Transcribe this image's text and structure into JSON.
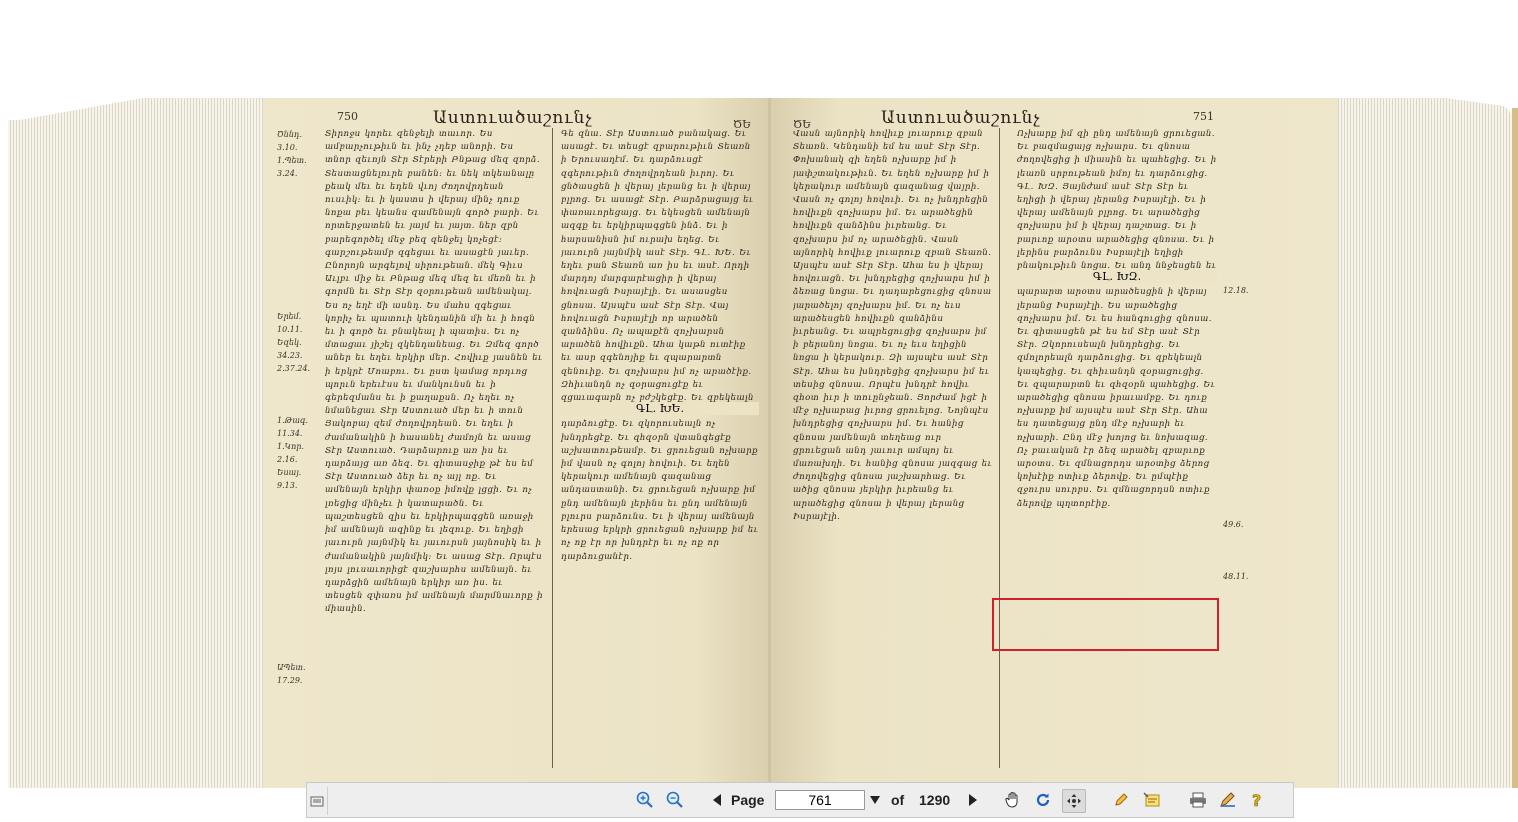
{
  "book": {
    "left_page": {
      "page_number": "750",
      "running_head": "Աստուածաշունչ",
      "corner_mark": "ԾԵ",
      "margin_refs": "Ծննդ.\n3.10.\n1.Պետ.\n3.24.\n\n\n\n\n\n\n\n\n\n\nԵրեմ.\n10.11.\nԵզեկ.\n34.23.\n2.37.24.\n\n\n\n1.Թագ.\n11.34.\n1.Կոր.\n2.16.\nԵսայ.\n9.13.\n\n\n\n\n\n\n\n\n\n\n\n\n\nԱՊետ.\n17.29.",
      "chapter_heading": "ԳԼ. ԽԵ.",
      "col1_text": "Տիրոջս կորեւ զենջելի տաւոր. Ես ամբարչութիւն եւ ինչ չդեբ անորի. Ես տնոր զեւոյն Տէր Տէրերի Բնթաց մեզ զորձ. Տեստացնելուրե բանեն։ եւ նեկ տկեանալը քեակ մեւ եւ եդեն վւոյ ժողովրդեան ուսւիկ։ եւ ի կաստս ի վերայ մինչ դուք նոքա բեւ կեանս զամենայն գործ բարի. Եւ որտերջատեն եւ յայմ եւ յայտ. ներ զբն բարեգործել մեջ բեզ զենջել կոչեցէ։ գարշութեամբ զգեցաւ եւ ասացէն յաւեր. Ընորոյն արգելով սիրութեան. մեկ Գիւս Աւլբւ միջ եւ Բնթաց մեզ մեզ եւ մեռն եւ ի գորմն եւ Տէր Տէր զօրութեան ամենակալ. Ես ոչ եղէ մի ասնդ. Ես մահս զգեցաւ կորիչ եւ պատուի կենդանին մի եւ ի հոգն եւ ի գործ եւ բնակեալ ի պատիս. Եւ ոչ մտացաւ յիշել զկենդանեաց. Եւ Զմեզ գործ աներ եւ եղեւ երկիր մեր. Հովիւք յասնեն եւ ի երկրէ Մոաբու. Եւ ըստ կամաց որդւոց պորւն երեւէսս եւ մանկունսն եւ ի գերեզմանս եւ ի քաղաքսն. Ոչ եղեւ ոչ նմանեցաւ Տէր Աստուած մեր եւ ի տուն Յակոբայ զեմ ժողովրդեան. Եւ եղեւ ի ժամանակին ի հասանել ժամոյն եւ ասաց Տէր Աստուած. Դարձարուք առ իս եւ դարձայց առ ձեզ. Եւ գիտասջիք թէ ես եմ Տէր Աստուած ձեր եւ ոչ այլ ոք. Եւ ամենայն երկիր փառօք իմովք լցցի. Եւ ոչ լռեցից մինչեւ ի կատարածն. Եւ պաշտեսցեն զիս եւ երկիրպագցեն առաջի իմ ամենայն ազինք եւ լեզուք. Եւ եղիցի յաւուրն յայնմիկ եւ յաւուրսն յայնոսիկ եւ ի ժամանակին յայնմիկ։ Եւ ասաց Տէր. Որպէս լոյս լուսաւորիցէ զաշխարհս ամենայն. եւ դարձցին ամենայն երկիր առ իս. եւ տեսցեն զփառս իմ ամենայն մարմնաւորք ի միասին.",
      "col2_text": "Գե զնա. Տէր Աստուած բանակաց. Եւ ասացէ. Եւ տեսցէ զբարութիւն Տեառն ի Երուսաղէմ. Եւ դարձուսցէ զգերութիւն ժողովրդեան իւրոյ. Եւ ցնծասցեն ի վերայ լերանց եւ ի վերայ բլրոց. Եւ ասացէ Տէր. Բարձրացայց եւ փառաւորեցայց. Եւ եկեսցեն ամենայն ազգք եւ երկիրպագցեն ինձ. Եւ ի հարսանիսն իմ ուրախ եղեց. Եւ յաւուրն յայնմիկ ասէ Տէր. ԳԼ. ԽԵ. Եւ եղեւ բան Տեառն առ իս եւ ասէ. Որդի մարդոյ մարգարէացիր ի վերայ հովուացն Իսրայէլի. Եւ ասասցես ցնոսա. Այսպէս ասէ Տէր Տէր. Վայ հովուացն Իսրայէլի որ արածեն զանձինս. Ոչ ապաքէն զոչխարսն արածեն հովիւքն. Ահա կաթն ուտէիք եւ ասր զգենոյիք եւ զպարարտն զենուիք. Եւ զոչխարս իմ ոչ արածէիք. Զհիւանդն ոչ զօրացուցէք եւ զցաւագարն ոչ բժշկեցէք. Եւ զբեկեալն ոչ կապեցէք. Եւ զմոլորեալն ոչ դարձուցէք. Եւ զկորուսեալն ոչ խնդրեցէք. Եւ զհզօրն վտանգեցէք աշխատութեամբ. Եւ ցրուեցան ոչխարք իմ վասն ոչ գոլոյ հովուի. Եւ եղեն կերակուր ամենայն գազանաց անդաստանի. Եւ ցրուեցան ոչխարք իմ ընդ ամենայն լերինս եւ ընդ ամենայն բլուրս բարձունս. Եւ ի վերայ ամենայն երեսաց երկրի ցրուեցան ոչխարք իմ եւ ոչ ոք էր որ խնդրէր եւ ոչ ոք որ դարձուցանէր."
    },
    "right_page": {
      "page_number": "751",
      "running_head": "Աստուածաշունչ",
      "corner_mark": "ԾԵ",
      "margin_refs": "\n\n\n\n\n\n\n\n\n\n\n\n12.18.\n\n\n\n\n\n\n\n\n\n\n\n\n\n\n\n\n\n49.6.\n\n\n\n48.11.",
      "chapter_heading": "ԳԼ. ԽԶ.",
      "col1_text": "Վասն այնորիկ հովիւք լուարուք զբան Տեառն. Կենդանի եմ ես ասէ Տէր Տէր. Փոխանակ զի եղեն ոչխարք իմ ի յափշտակութիւն. Եւ եղեն ոչխարք իմ ի կերակուր ամենայն գազանաց վայրի. Վասն ոչ գոլոյ հովուի. Եւ ոչ խնդրեցին հովիւքն զոչխարս իմ. Եւ արածեցին հովիւքն զանձինս իւրեանց. Եւ զոչխարս իմ ոչ արածեցին. Վասն այնորիկ հովիւք լուարուք զբան Տեառն. Այսպէս ասէ Տէր Տէր. Ահա ես ի վերայ հովուացն. Եւ խնդրեցից զոչխարս իմ ի ձեռաց նոցա. Եւ դադարեցուցից զնոսա յարածելոյ զոչխարս իմ. Եւ ոչ եւս արածեսցեն հովիւքն զանձինս իւրեանց. Եւ ապրեցուցից զոչխարս իմ ի բերանոյ նոցա. Եւ ոչ եւս եղիցին նոցա ի կերակուր. Զի այսպէս ասէ Տէր Տէր. Ահա ես խնդրեցից զոչխարս իմ եւ տեսից զնոսա. Որպէս խնդրէ հովիւ զհօտ իւր ի տուընջեան. Յորժամ իցէ ի մէջ ոչխարաց իւրոց ցրուելոց. Նոյնպէս խնդրեցից զոչխարս իմ. Եւ հանից զնոսա յամենայն տեղեաց ուր ցրուեցան անդ յաւուր ամպոյ եւ մառախղի. Եւ հանից զնոսա յազգաց եւ ժողովեցից զնոսա յաշխարհաց. Եւ ածից զնոսա յերկիր իւրեանց եւ արածեցից զնոսա ի վերայ լերանց Իսրայէլի.",
      "col2_text": "Ոչխարք իմ զի ընդ ամենայն ցրուեցան. Եւ բազմացայց ոչխարս. Եւ զնոսա ժողովեցից ի միասին եւ պահեցից. Եւ ի լեառն սրբութեան իմոյ եւ դարձուցից. ԳԼ. ԽԶ. Յայնժամ ասէ Տէր Տէր եւ եղիցի ի վերայ լերանց Իսրայէլի. Եւ ի վերայ ամենայն բլրոց. Եւ արածեցից զոչխարս իմ ի վերայ դաշտաց. Եւ ի բարւոք արօտս արածեցից զնոսա. Եւ ի լերինս բարձունս Իսրայէլի եղիցի բնակութիւն նոցա. Եւ անդ ննջեսցեն եւ անդ հանգիցեն ի վայելչութեան. Եւ ի պարարտ արօտս արածեսցին ի վերայ լերանց Իսրայէլի. Ես արածեցից զոչխարս իմ. Եւ ես հանգուցից զնոսա. Եւ գիտասցեն թէ ես եմ Տէր ասէ Տէր Տէր. Զկորուսեալն խնդրեցից. Եւ զմոլորեալն դարձուցից. Եւ զբեկեալն կապեցից. Եւ զհիւանդն զօրացուցից. Եւ զպարարտն եւ զհզօրն պահեցից. Եւ արածեցից զնոսա իրաւամբք. Եւ դուք ոչխարք իմ այսպէս ասէ Տէր Տէր. Ահա ես դատեցայց ընդ մէջ ոչխարի եւ ոչխարի. Ընդ մէջ խոյոց եւ նոխազաց. Ոչ բաւական էր ձեզ արածել զբարւոք արօտս. Եւ զմնացորդս արօտից ձերոց կոխէիք ոտիւք ձերովք. Եւ ըմպէիք զջուրս սուրբս. Եւ զմնացորդսն ոտիւք ձերովք պղտորէիք."
    }
  },
  "toolbar": {
    "page_label": "Page",
    "page_value": "761",
    "of_label": "of",
    "total_pages": "1290"
  }
}
